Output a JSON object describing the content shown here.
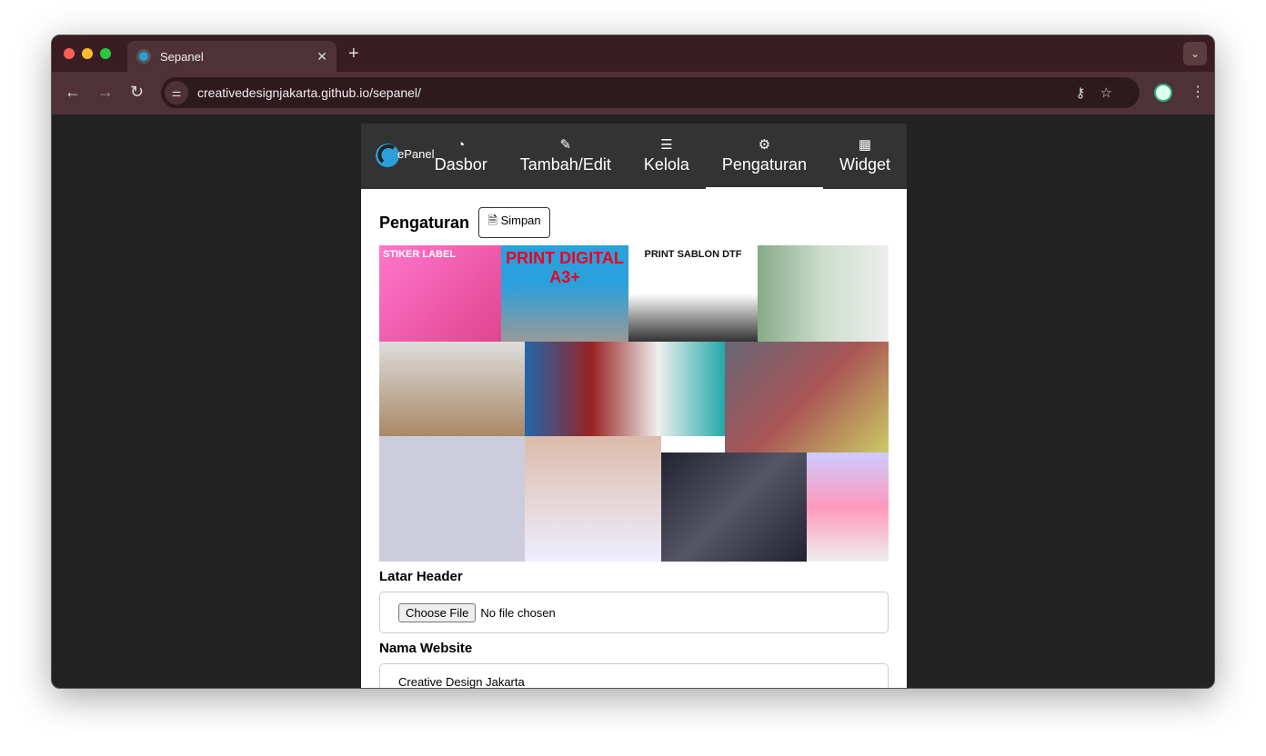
{
  "browser": {
    "tab_title": "Sepanel",
    "url": "creativedesignjakarta.github.io/sepanel/"
  },
  "nav": {
    "logo": "SePanel",
    "items": [
      {
        "label": "Dasbor",
        "icon": "dashboard-icon",
        "glyph": "◔"
      },
      {
        "label": "Tambah/Edit",
        "icon": "edit-icon",
        "glyph": "✎"
      },
      {
        "label": "Kelola",
        "icon": "list-icon",
        "glyph": "☰"
      },
      {
        "label": "Pengaturan",
        "icon": "gear-icon",
        "glyph": "⚙",
        "active": true
      },
      {
        "label": "Widget",
        "icon": "widget-icon",
        "glyph": "▦"
      }
    ]
  },
  "main": {
    "title": "Pengaturan",
    "save_label": "Simpan",
    "header_image_text": [
      "STIKER LABEL",
      "PRINT DIGITAL A3+",
      "PRINT SABLON DTF"
    ],
    "fields": [
      {
        "label": "Latar Header",
        "button": "Choose File",
        "value": "No file chosen"
      },
      {
        "label": "Nama Website",
        "value": "Creative Design Jakarta"
      }
    ]
  }
}
